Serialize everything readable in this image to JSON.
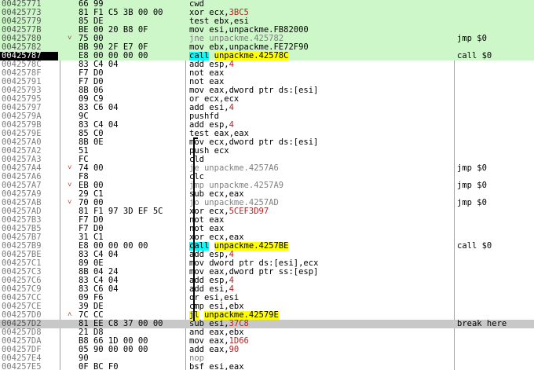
{
  "rows": [
    {
      "addr": "00425771",
      "bytes": "66 99",
      "mnem": "cwd",
      "ops": "",
      "comment": "",
      "style": "hl-green",
      "kind": "plain"
    },
    {
      "addr": "00425773",
      "bytes": "81 F1 C5 3B 00 00",
      "mnem": "xor",
      "ops": "ecx,3BC5",
      "comment": "",
      "style": "hl-green",
      "kind": "plain"
    },
    {
      "addr": "00425779",
      "bytes": "85 DE",
      "mnem": "test",
      "ops": "ebx,esi",
      "comment": "",
      "style": "hl-green",
      "kind": "plain"
    },
    {
      "addr": "0042577B",
      "bytes": "BE 00 20 B8 0F",
      "mnem": "mov",
      "ops": "esi,unpackme.FB82000",
      "comment": "",
      "style": "hl-green",
      "kind": "plain"
    },
    {
      "addr": "00425780",
      "bytes": "75 00",
      "mnem": "jne",
      "ops": "unpackme.425782",
      "comment": "jmp $0",
      "style": "hl-green",
      "kind": "jmpl",
      "arrow": "v"
    },
    {
      "addr": "00425782",
      "bytes": "BB 90 2F E7 0F",
      "mnem": "mov",
      "ops": "ebx,unpackme.FE72F90",
      "comment": "",
      "style": "hl-green",
      "kind": "plain"
    },
    {
      "addr": "00425787",
      "bytes": "E8 00 00 00 00",
      "mnem": "call",
      "ops": "unpackme.42578C",
      "comment": "call $0",
      "style": "hl-current",
      "kind": "call"
    },
    {
      "addr": "0042578C",
      "bytes": "83 C4 04",
      "mnem": "add",
      "ops": "esp,4",
      "comment": "",
      "style": "",
      "kind": "plain"
    },
    {
      "addr": "0042578F",
      "bytes": "F7 D0",
      "mnem": "not",
      "ops": "eax",
      "comment": "",
      "style": "",
      "kind": "plain"
    },
    {
      "addr": "00425791",
      "bytes": "F7 D0",
      "mnem": "not",
      "ops": "eax",
      "comment": "",
      "style": "",
      "kind": "plain"
    },
    {
      "addr": "00425793",
      "bytes": "8B 06",
      "mnem": "mov",
      "ops": "eax,dword ptr ds:[esi]",
      "comment": "",
      "style": "",
      "kind": "plain"
    },
    {
      "addr": "00425795",
      "bytes": "09 C9",
      "mnem": "or",
      "ops": "ecx,ecx",
      "comment": "",
      "style": "",
      "kind": "plain"
    },
    {
      "addr": "00425797",
      "bytes": "83 C6 04",
      "mnem": "add",
      "ops": "esi,4",
      "comment": "",
      "style": "",
      "kind": "plain"
    },
    {
      "addr": "0042579A",
      "bytes": "9C",
      "mnem": "pushfd",
      "ops": "",
      "comment": "",
      "style": "",
      "kind": "plain"
    },
    {
      "addr": "0042579B",
      "bytes": "83 C4 04",
      "mnem": "add",
      "ops": "esp,4",
      "comment": "",
      "style": "",
      "kind": "plain"
    },
    {
      "addr": "0042579E",
      "bytes": "85 C0",
      "mnem": "test",
      "ops": "eax,eax",
      "comment": "",
      "style": "",
      "kind": "plain"
    },
    {
      "addr": "004257A0",
      "bytes": "8B 0E",
      "mnem": "mov",
      "ops": "ecx,dword ptr ds:[esi]",
      "comment": "",
      "style": "",
      "kind": "plain"
    },
    {
      "addr": "004257A2",
      "bytes": "51",
      "mnem": "push",
      "ops": "ecx",
      "comment": "",
      "style": "",
      "kind": "plain"
    },
    {
      "addr": "004257A3",
      "bytes": "FC",
      "mnem": "cld",
      "ops": "",
      "comment": "",
      "style": "",
      "kind": "plain"
    },
    {
      "addr": "004257A4",
      "bytes": "74 00",
      "mnem": "je",
      "ops": "unpackme.4257A6",
      "comment": "jmp $0",
      "style": "",
      "kind": "jmpl",
      "arrow": "v"
    },
    {
      "addr": "004257A6",
      "bytes": "F8",
      "mnem": "clc",
      "ops": "",
      "comment": "",
      "style": "",
      "kind": "plain"
    },
    {
      "addr": "004257A7",
      "bytes": "EB 00",
      "mnem": "jmp",
      "ops": "unpackme.4257A9",
      "comment": "jmp $0",
      "style": "",
      "kind": "jmpl",
      "arrow": "v"
    },
    {
      "addr": "004257A9",
      "bytes": "29 C1",
      "mnem": "sub",
      "ops": "ecx,eax",
      "comment": "",
      "style": "",
      "kind": "plain"
    },
    {
      "addr": "004257AB",
      "bytes": "70 00",
      "mnem": "jo",
      "ops": "unpackme.4257AD",
      "comment": "jmp $0",
      "style": "",
      "kind": "jmpl",
      "arrow": "v"
    },
    {
      "addr": "004257AD",
      "bytes": "81 F1 97 3D EF 5C",
      "mnem": "xor",
      "ops": "ecx,5CEF3D97",
      "comment": "",
      "style": "",
      "kind": "plain"
    },
    {
      "addr": "004257B3",
      "bytes": "F7 D0",
      "mnem": "not",
      "ops": "eax",
      "comment": "",
      "style": "",
      "kind": "plain"
    },
    {
      "addr": "004257B5",
      "bytes": "F7 D0",
      "mnem": "not",
      "ops": "eax",
      "comment": "",
      "style": "",
      "kind": "plain"
    },
    {
      "addr": "004257B7",
      "bytes": "31 C1",
      "mnem": "xor",
      "ops": "ecx,eax",
      "comment": "",
      "style": "",
      "kind": "plain"
    },
    {
      "addr": "004257B9",
      "bytes": "E8 00 00 00 00",
      "mnem": "call",
      "ops": "unpackme.4257BE",
      "comment": "call $0",
      "style": "",
      "kind": "call"
    },
    {
      "addr": "004257BE",
      "bytes": "83 C4 04",
      "mnem": "add",
      "ops": "esp,4",
      "comment": "",
      "style": "",
      "kind": "plain"
    },
    {
      "addr": "004257C1",
      "bytes": "89 0E",
      "mnem": "mov",
      "ops": "dword ptr ds:[esi],ecx",
      "comment": "",
      "style": "",
      "kind": "plain"
    },
    {
      "addr": "004257C3",
      "bytes": "8B 04 24",
      "mnem": "mov",
      "ops": "eax,dword ptr ss:[esp]",
      "comment": "",
      "style": "",
      "kind": "plain"
    },
    {
      "addr": "004257C6",
      "bytes": "83 C4 04",
      "mnem": "add",
      "ops": "esp,4",
      "comment": "",
      "style": "",
      "kind": "plain"
    },
    {
      "addr": "004257C9",
      "bytes": "83 C6 04",
      "mnem": "add",
      "ops": "esi,4",
      "comment": "",
      "style": "",
      "kind": "plain"
    },
    {
      "addr": "004257CC",
      "bytes": "09 F6",
      "mnem": "or",
      "ops": "esi,esi",
      "comment": "",
      "style": "",
      "kind": "plain"
    },
    {
      "addr": "004257CE",
      "bytes": "39 DE",
      "mnem": "cmp",
      "ops": "esi,ebx",
      "comment": "",
      "style": "",
      "kind": "plain"
    },
    {
      "addr": "004257D0",
      "bytes": "7C CC",
      "mnem": "jl",
      "ops": "unpackme.42579E",
      "comment": "",
      "style": "",
      "kind": "jl",
      "arrow": "^"
    },
    {
      "addr": "004257D2",
      "bytes": "81 EE C8 37 00 00",
      "mnem": "sub",
      "ops": "esi,37C8",
      "comment": "break here",
      "style": "hl-grey",
      "kind": "plain"
    },
    {
      "addr": "004257D8",
      "bytes": "21 D8",
      "mnem": "and",
      "ops": "eax,ebx",
      "comment": "",
      "style": "",
      "kind": "plain"
    },
    {
      "addr": "004257DA",
      "bytes": "B8 66 1D 00 00",
      "mnem": "mov",
      "ops": "eax,1D66",
      "comment": "",
      "style": "",
      "kind": "plain"
    },
    {
      "addr": "004257DF",
      "bytes": "05 90 00 00 00",
      "mnem": "add",
      "ops": "eax,90",
      "comment": "",
      "style": "",
      "kind": "plain"
    },
    {
      "addr": "004257E4",
      "bytes": "90",
      "mnem": "nop",
      "ops": "",
      "comment": "",
      "style": "",
      "kind": "jmpl"
    },
    {
      "addr": "004257E5",
      "bytes": "0F BC F0",
      "mnem": "bsf",
      "ops": "esi,eax",
      "comment": "",
      "style": "",
      "kind": "plain"
    }
  ]
}
